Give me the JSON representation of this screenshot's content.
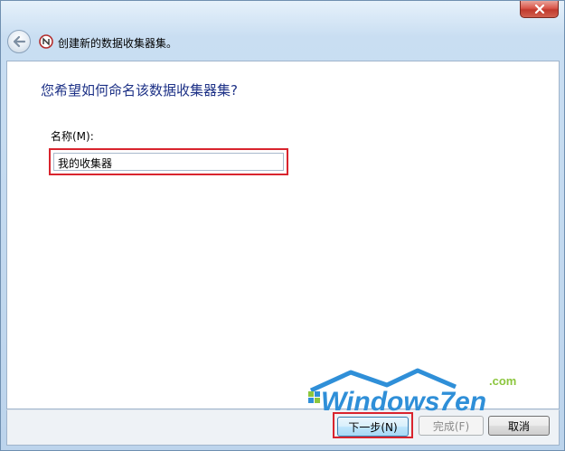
{
  "window": {
    "nav_title": "创建新的数据收集器集。"
  },
  "page": {
    "heading": "您希望如何命名该数据收集器集?",
    "name_label": "名称(M):",
    "name_value": "我的收集器"
  },
  "watermark": {
    "brand": "Windows7en",
    "domain": ".com"
  },
  "buttons": {
    "next": "下一步(N)",
    "finish": "完成(F)",
    "cancel": "取消"
  },
  "colors": {
    "heading": "#1e3287",
    "highlight": "#d9242e",
    "close_button": "#c13a2d"
  },
  "icons": {
    "close": "close-icon",
    "back": "back-arrow-icon",
    "wizard": "data-collector-icon"
  }
}
